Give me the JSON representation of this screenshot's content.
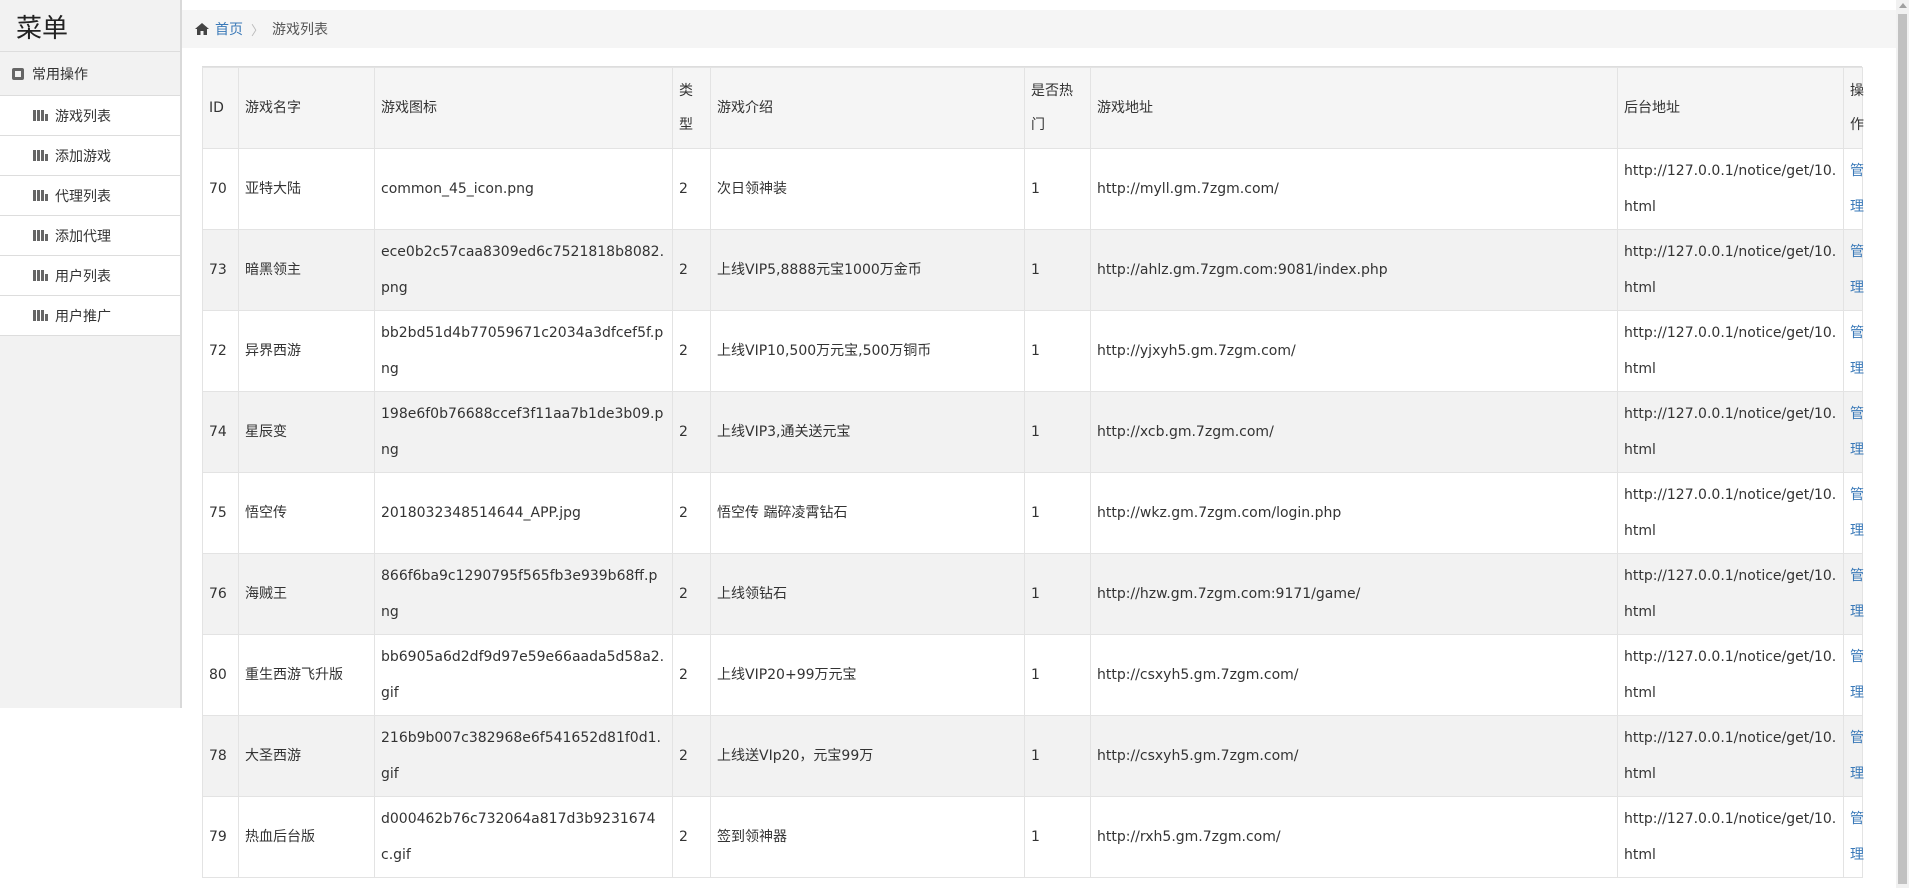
{
  "sidebar": {
    "title": "菜单",
    "group": "常用操作",
    "items": [
      {
        "label": "游戏列表"
      },
      {
        "label": "添加游戏"
      },
      {
        "label": "代理列表"
      },
      {
        "label": "添加代理"
      },
      {
        "label": "用户列表"
      },
      {
        "label": "用户推广"
      }
    ]
  },
  "breadcrumb": {
    "home": "首页",
    "separator": "〉",
    "current": "游戏列表"
  },
  "table": {
    "headers": {
      "id": "ID",
      "name": "游戏名字",
      "icon": "游戏图标",
      "type": "类型",
      "intro": "游戏介绍",
      "hot": "是否热门",
      "url": "游戏地址",
      "admin": "后台地址",
      "op": "操作"
    },
    "rows": [
      {
        "id": "70",
        "name": "亚特大陆",
        "icon": "common_45_icon.png",
        "type": "2",
        "intro": "次日领神装",
        "hot": "1",
        "url": "http://myll.gm.7zgm.com/",
        "admin": "http://127.0.0.1/notice/get/10.html",
        "op": "管理"
      },
      {
        "id": "73",
        "name": "暗黑领主",
        "icon": "ece0b2c57caa8309ed6c7521818b8082.png",
        "type": "2",
        "intro": "上线VIP5,8888元宝1000万金币",
        "hot": "1",
        "url": "http://ahlz.gm.7zgm.com:9081/index.php",
        "admin": "http://127.0.0.1/notice/get/10.html",
        "op": "管理"
      },
      {
        "id": "72",
        "name": "异界西游",
        "icon": "bb2bd51d4b77059671c2034a3dfcef5f.png",
        "type": "2",
        "intro": "上线VIP10,500万元宝,500万铜币",
        "hot": "1",
        "url": "http://yjxyh5.gm.7zgm.com/",
        "admin": "http://127.0.0.1/notice/get/10.html",
        "op": "管理"
      },
      {
        "id": "74",
        "name": "星辰变",
        "icon": "198e6f0b76688ccef3f11aa7b1de3b09.png",
        "type": "2",
        "intro": "上线VIP3,通关送元宝",
        "hot": "1",
        "url": "http://xcb.gm.7zgm.com/",
        "admin": "http://127.0.0.1/notice/get/10.html",
        "op": "管理"
      },
      {
        "id": "75",
        "name": "悟空传",
        "icon": "2018032348514644_APP.jpg",
        "type": "2",
        "intro": "悟空传 踹碎凌霄钻石",
        "hot": "1",
        "url": "http://wkz.gm.7zgm.com/login.php",
        "admin": "http://127.0.0.1/notice/get/10.html",
        "op": "管理"
      },
      {
        "id": "76",
        "name": "海贼王",
        "icon": "866f6ba9c1290795f565fb3e939b68ff.png",
        "type": "2",
        "intro": "上线领钻石",
        "hot": "1",
        "url": "http://hzw.gm.7zgm.com:9171/game/",
        "admin": "http://127.0.0.1/notice/get/10.html",
        "op": "管理"
      },
      {
        "id": "80",
        "name": "重生西游飞升版",
        "icon": "bb6905a6d2df9d97e59e66aada5d58a2.gif",
        "type": "2",
        "intro": "上线VIP20+99万元宝",
        "hot": "1",
        "url": "http://csxyh5.gm.7zgm.com/",
        "admin": "http://127.0.0.1/notice/get/10.html",
        "op": "管理"
      },
      {
        "id": "78",
        "name": "大圣西游",
        "icon": "216b9b007c382968e6f541652d81f0d1.gif",
        "type": "2",
        "intro": "上线送VIp20，元宝99万",
        "hot": "1",
        "url": "http://csxyh5.gm.7zgm.com/",
        "admin": "http://127.0.0.1/notice/get/10.html",
        "op": "管理"
      },
      {
        "id": "79",
        "name": "热血后台版",
        "icon": "d000462b76c732064a817d3b9231674c.gif",
        "type": "2",
        "intro": "签到领神器",
        "hot": "1",
        "url": "http://rxh5.gm.7zgm.com/",
        "admin": "http://127.0.0.1/notice/get/10.html",
        "op": "管理"
      }
    ]
  },
  "colors": {
    "link": "#3a79b8",
    "sidebar_bg": "#f2f2f2",
    "header_bg": "#f5f5f5"
  }
}
